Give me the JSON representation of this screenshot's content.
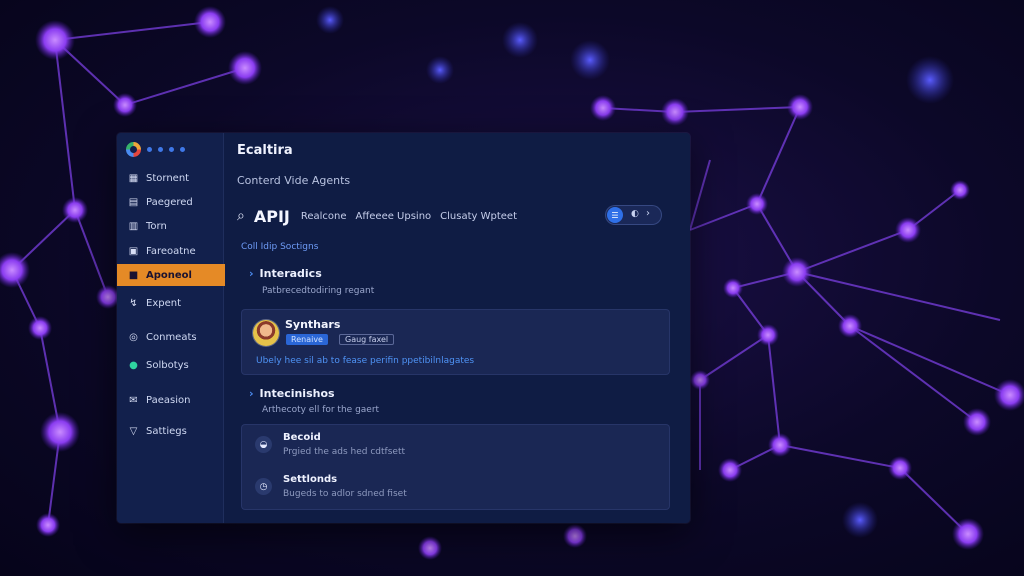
{
  "app": {
    "title": "Ecaltira",
    "subtitle": "Conterd Vide Agents"
  },
  "header": {
    "btn1_glyph": "A",
    "btn2_glyph": "▯"
  },
  "search": {
    "query": "APIJ",
    "tabs": [
      "Realcone",
      "Affeeee Upsino",
      "Clusaty Wpteet"
    ],
    "toggle_knob": "☰",
    "toggle_icon": "◐",
    "toggle_chevron": "›"
  },
  "sidebar": {
    "items": [
      {
        "label": "Stornent",
        "icon": "grid-icon",
        "glyph": "▦"
      },
      {
        "label": "Paegered",
        "icon": "layers-icon",
        "glyph": "▤"
      },
      {
        "label": "Torn",
        "icon": "book-icon",
        "glyph": "▥"
      },
      {
        "label": "Fareoatne",
        "icon": "document-icon",
        "glyph": "▣"
      },
      {
        "label": "Aponeol",
        "icon": "folder-icon",
        "glyph": "■",
        "active": true
      },
      {
        "label": "Expent",
        "icon": "export-icon",
        "glyph": "↯"
      },
      {
        "label": "Conmeats",
        "icon": "comment-icon",
        "glyph": "◎"
      },
      {
        "label": "Solbotys",
        "icon": "status-icon",
        "glyph": "●"
      },
      {
        "label": "Paeasion",
        "icon": "key-icon",
        "glyph": "✉"
      },
      {
        "label": "Sattiegs",
        "icon": "settings-icon",
        "glyph": "▽"
      }
    ]
  },
  "section_label": "Coll Idip Soctigns",
  "groups": [
    {
      "title": "Interadics",
      "desc": "Patbrecedtodiring regant"
    },
    {
      "title": "Intecinishos",
      "desc": "Arthecoty ell for the gaert"
    }
  ],
  "card1": {
    "title": "Synthars",
    "badge_blue": "Renaive",
    "badge_dark": "Gaug faxel",
    "link": "Ubely hee sil ab to fease perifin ppetibilnlagates"
  },
  "card2": {
    "rows": [
      {
        "title": "Becoid",
        "desc": "Prgied the ads hed cdtfsett",
        "glyph": "◒"
      },
      {
        "title": "Settlonds",
        "desc": "Bugeds to adlor sdned fiset",
        "glyph": "◷"
      }
    ]
  },
  "colors": {
    "accent_orange": "#e58a26",
    "accent_blue": "#2f70e8",
    "link_blue": "#4f93f5",
    "panel": "#0f1c44",
    "node_purple": "#8a3cf0"
  }
}
